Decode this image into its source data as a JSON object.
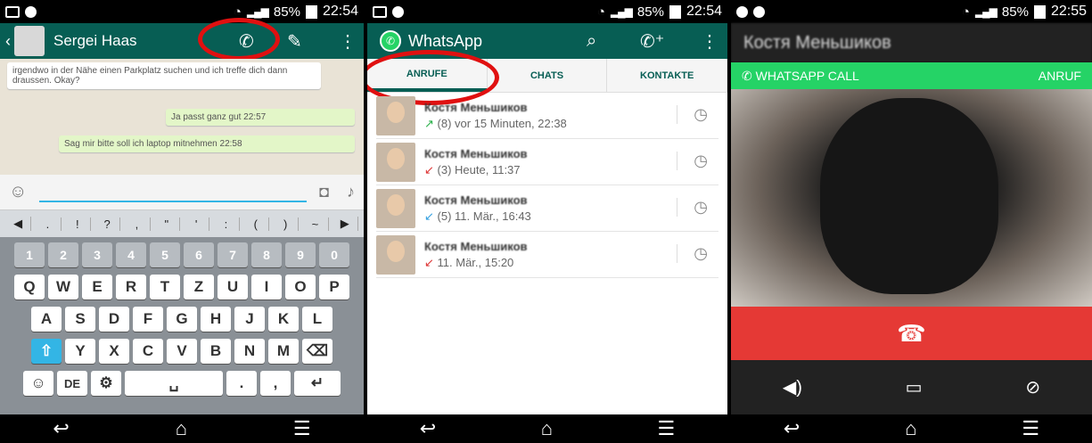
{
  "status": [
    {
      "battery": "85%",
      "time": "22:54"
    },
    {
      "battery": "85%",
      "time": "22:54"
    },
    {
      "battery": "85%",
      "time": "22:55"
    }
  ],
  "chat": {
    "contact": "Sergei Haas",
    "messages": [
      {
        "text": "irgendwo in der Nähe einen Parkplatz suchen und ich treffe dich dann draussen. Okay?",
        "dir": "in"
      },
      {
        "text": "Ja passt ganz gut",
        "dir": "out",
        "time": "22:57"
      },
      {
        "text": "Sag mir bitte soll ich laptop mitnehmen",
        "dir": "out",
        "time": "22:58"
      }
    ],
    "sym_keys": [
      "◀",
      ".",
      "!",
      "?",
      ",",
      "\"",
      "'",
      ":",
      "(",
      ")",
      "~",
      "▶"
    ],
    "num_keys": [
      "1",
      "2",
      "3",
      "4",
      "5",
      "6",
      "7",
      "8",
      "9",
      "0"
    ],
    "row1": [
      "Q",
      "W",
      "E",
      "R",
      "T",
      "Z",
      "U",
      "I",
      "O",
      "P"
    ],
    "row2": [
      "A",
      "S",
      "D",
      "F",
      "G",
      "H",
      "J",
      "K",
      "L"
    ],
    "row3": [
      "Y",
      "X",
      "C",
      "V",
      "B",
      "N",
      "M"
    ],
    "lang_key": "DE"
  },
  "whatsapp": {
    "title": "WhatsApp",
    "tabs": [
      "ANRUFE",
      "CHATS",
      "KONTAKTE"
    ],
    "calls": [
      {
        "name": "Костя Меньшиков",
        "detail": "(8) vor 15 Minuten, 22:38",
        "arrow": "↗",
        "type": "out"
      },
      {
        "name": "Костя Меньшиков",
        "detail": "(3) Heute, 11:37",
        "arrow": "↙",
        "type": "in"
      },
      {
        "name": "Костя Меньшиков",
        "detail": "(5) 11. Mär., 16:43",
        "arrow": "↙",
        "type": "in2"
      },
      {
        "name": "Костя Меньшиков",
        "detail": "11. Mär., 15:20",
        "arrow": "↙",
        "type": "in"
      }
    ]
  },
  "callscreen": {
    "caller": "Костя Меньшиков",
    "label_left": "WHATSAPP CALL",
    "label_right": "ANRUF"
  },
  "colors": {
    "brand": "#075e54",
    "green": "#25d366",
    "hangup": "#e53935",
    "highlight": "#e01010"
  }
}
